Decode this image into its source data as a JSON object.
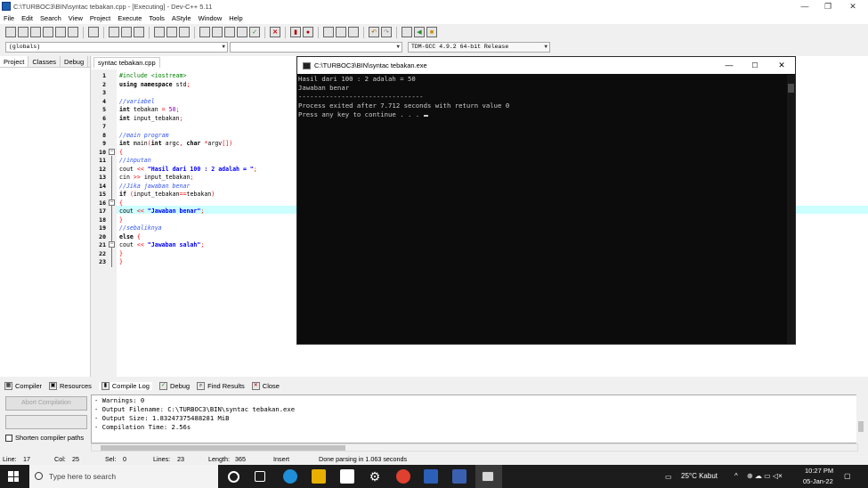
{
  "window": {
    "title": "C:\\TURBOC3\\BIN\\syntac tebakan.cpp - [Executing] - Dev-C++ 5.11",
    "min": "—",
    "max": "❐",
    "close": "✕"
  },
  "menu": [
    "File",
    "Edit",
    "Search",
    "View",
    "Project",
    "Execute",
    "Tools",
    "AStyle",
    "Window",
    "Help"
  ],
  "toolbar2": {
    "scope": "(globals)",
    "compiler": "TDM-GCC 4.9.2 64-bit Release"
  },
  "left_panel": {
    "tabs": [
      "Project",
      "Classes",
      "Debug"
    ]
  },
  "editor": {
    "file_tab": "syntac tebakan.cpp",
    "lines": [
      "1",
      "2",
      "3",
      "4",
      "5",
      "6",
      "7",
      "8",
      "9",
      "10",
      "11",
      "12",
      "13",
      "14",
      "15",
      "16",
      "17",
      "18",
      "19",
      "20",
      "21",
      "22",
      "23"
    ]
  },
  "console": {
    "title": "C:\\TURBOC3\\BIN\\syntac tebakan.exe",
    "lines": [
      "Hasil dari 100 : 2 adalah = 50",
      "Jawaban benar",
      "--------------------------------",
      "Process exited after 7.712 seconds with return value 0",
      "Press any key to continue . . . "
    ]
  },
  "bottom_tabs": [
    "Compiler",
    "Resources",
    "Compile Log",
    "Debug",
    "Find Results",
    "Close"
  ],
  "bottom_panel": {
    "abort_label": "Abort Compilation",
    "shorten_label": "Shorten compiler paths",
    "log": [
      "- Warnings: 0",
      "- Output Filename: C:\\TURBOC3\\BIN\\syntac tebakan.exe",
      "- Output Size: 1.83247375488281 MiB",
      "- Compilation Time: 2.56s"
    ]
  },
  "status": {
    "line_label": "Line:",
    "line": "17",
    "col_label": "Col:",
    "col": "25",
    "sel_label": "Sel:",
    "sel": "0",
    "lines_label": "Lines:",
    "lines": "23",
    "length_label": "Length:",
    "length": "365",
    "mode": "Insert",
    "message": "Done parsing in 1.063 seconds"
  },
  "taskbar": {
    "search_placeholder": "Type here to search",
    "weather": "25°C Kabut",
    "time": "10:27 PM",
    "date": "05-Jan-22"
  },
  "colors": {
    "console_bg": "#0c0c0c",
    "highlight_line": "#ccffff",
    "comment": "#3355ee",
    "string": "#0000ff",
    "operator": "#ff0000"
  }
}
